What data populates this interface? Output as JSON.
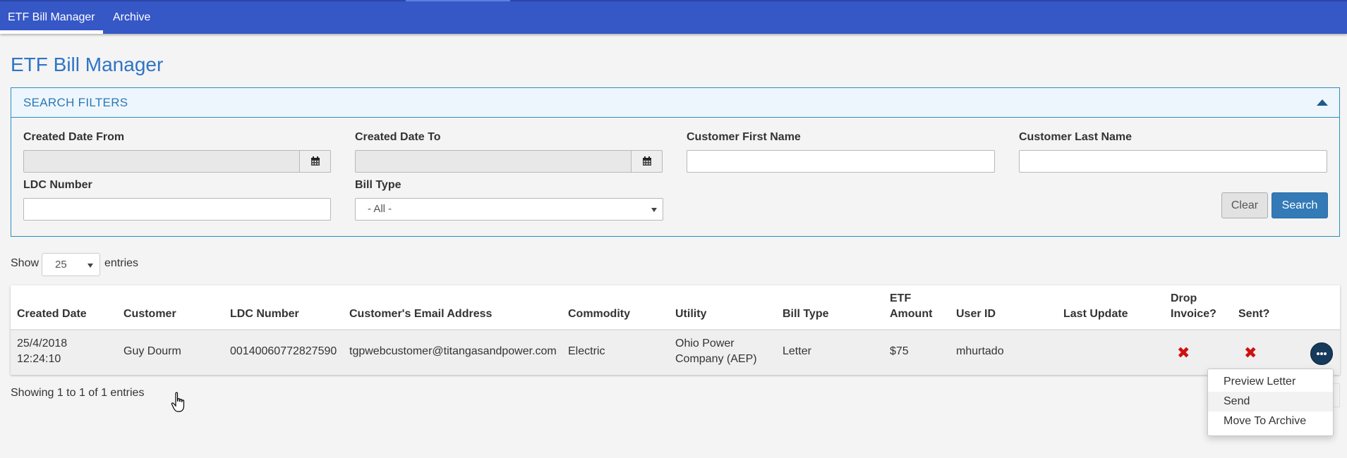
{
  "nav": {
    "tabs": [
      {
        "label": "ETF Bill Manager",
        "active": true
      },
      {
        "label": "Archive",
        "active": false
      }
    ]
  },
  "page": {
    "title": "ETF Bill Manager"
  },
  "filters": {
    "title": "SEARCH FILTERS",
    "created_from_label": "Created Date From",
    "created_from_value": "",
    "created_to_label": "Created Date To",
    "created_to_value": "",
    "first_name_label": "Customer First Name",
    "first_name_value": "",
    "last_name_label": "Customer Last Name",
    "last_name_value": "",
    "ldc_label": "LDC Number",
    "ldc_value": "",
    "bill_type_label": "Bill Type",
    "bill_type_value": "- All -",
    "clear_label": "Clear",
    "search_label": "Search"
  },
  "entries": {
    "show_label": "Show",
    "value": "25",
    "suffix": "entries"
  },
  "table": {
    "headers": {
      "created": "Created Date",
      "customer": "Customer",
      "ldc": "LDC Number",
      "email": "Customer's Email Address",
      "commodity": "Commodity",
      "utility": "Utility",
      "bill_type": "Bill Type",
      "etf_1": "ETF",
      "etf_2": "Amount",
      "user": "User ID",
      "last_update": "Last Update",
      "drop_1": "Drop",
      "drop_2": "Invoice?",
      "sent": "Sent?"
    },
    "rows": [
      {
        "created_1": "25/4/2018",
        "created_2": "12:24:10",
        "customer": "Guy Dourm",
        "ldc": "00140060772827590",
        "email": "tgpwebcustomer@titangasandpower.com",
        "commodity": "Electric",
        "utility_1": "Ohio Power",
        "utility_2": "Company (AEP)",
        "bill_type": "Letter",
        "etf_amount": "$75",
        "user": "mhurtado",
        "last_update": "",
        "drop_invoice": "✖",
        "sent": "✖"
      }
    ],
    "info": "Showing 1 to 1 of 1 entries"
  },
  "row_menu": {
    "items": [
      {
        "label": "Preview Letter"
      },
      {
        "label": "Send"
      },
      {
        "label": "Move To Archive"
      }
    ]
  },
  "colors": {
    "nav": "#3657c6",
    "accent": "#2f74c6",
    "primary_button": "#337ab7",
    "no_mark": "#d01010"
  },
  "icons": [
    "calendar-icon",
    "chevron-up-icon",
    "more-icon",
    "hand-cursor-icon"
  ]
}
